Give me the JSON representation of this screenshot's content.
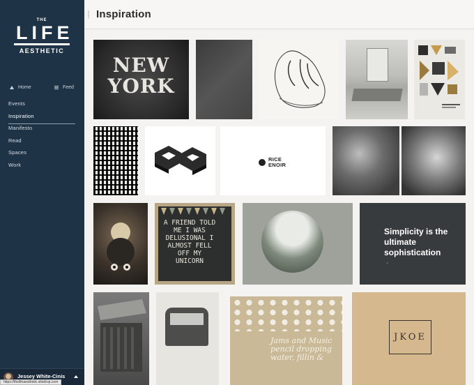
{
  "brand": {
    "the": "THE",
    "life": "LIFE",
    "aesthetic": "AESTHETIC"
  },
  "quicknav": {
    "home": "Home",
    "feed": "Feed"
  },
  "sidebar": {
    "items": [
      {
        "label": "Events",
        "active": false
      },
      {
        "label": "Inspiration",
        "active": true
      },
      {
        "label": "Manifesto",
        "active": false
      },
      {
        "label": "Read",
        "active": false
      },
      {
        "label": "Spaces",
        "active": false
      },
      {
        "label": "Work",
        "active": false
      }
    ]
  },
  "user": {
    "name": "Jessey White-Cinis"
  },
  "status_url": "https://thelifeaesthetic.sitedrop.com",
  "header": {
    "title": "Inspiration"
  },
  "tiles": {
    "ny": {
      "line1": "NEW",
      "line2": "YORK"
    },
    "rice": {
      "line1": "RICE",
      "line2": "ENOIR"
    },
    "chalk": {
      "text": "A FRIEND TOLD ME I WAS DELUSIONAL I ALMOST FELL OFF MY UNICORN"
    },
    "simplicity": {
      "text": "Simplicity is the ultimate sophistication"
    },
    "dots": {
      "text": "Jams and Music pencil dropping water, fillin &"
    },
    "kraft": {
      "text": "JKOE"
    }
  },
  "colors": {
    "sidebar": "#1f3346",
    "accent_white": "#ffffff",
    "background": "#f4f3f1"
  }
}
